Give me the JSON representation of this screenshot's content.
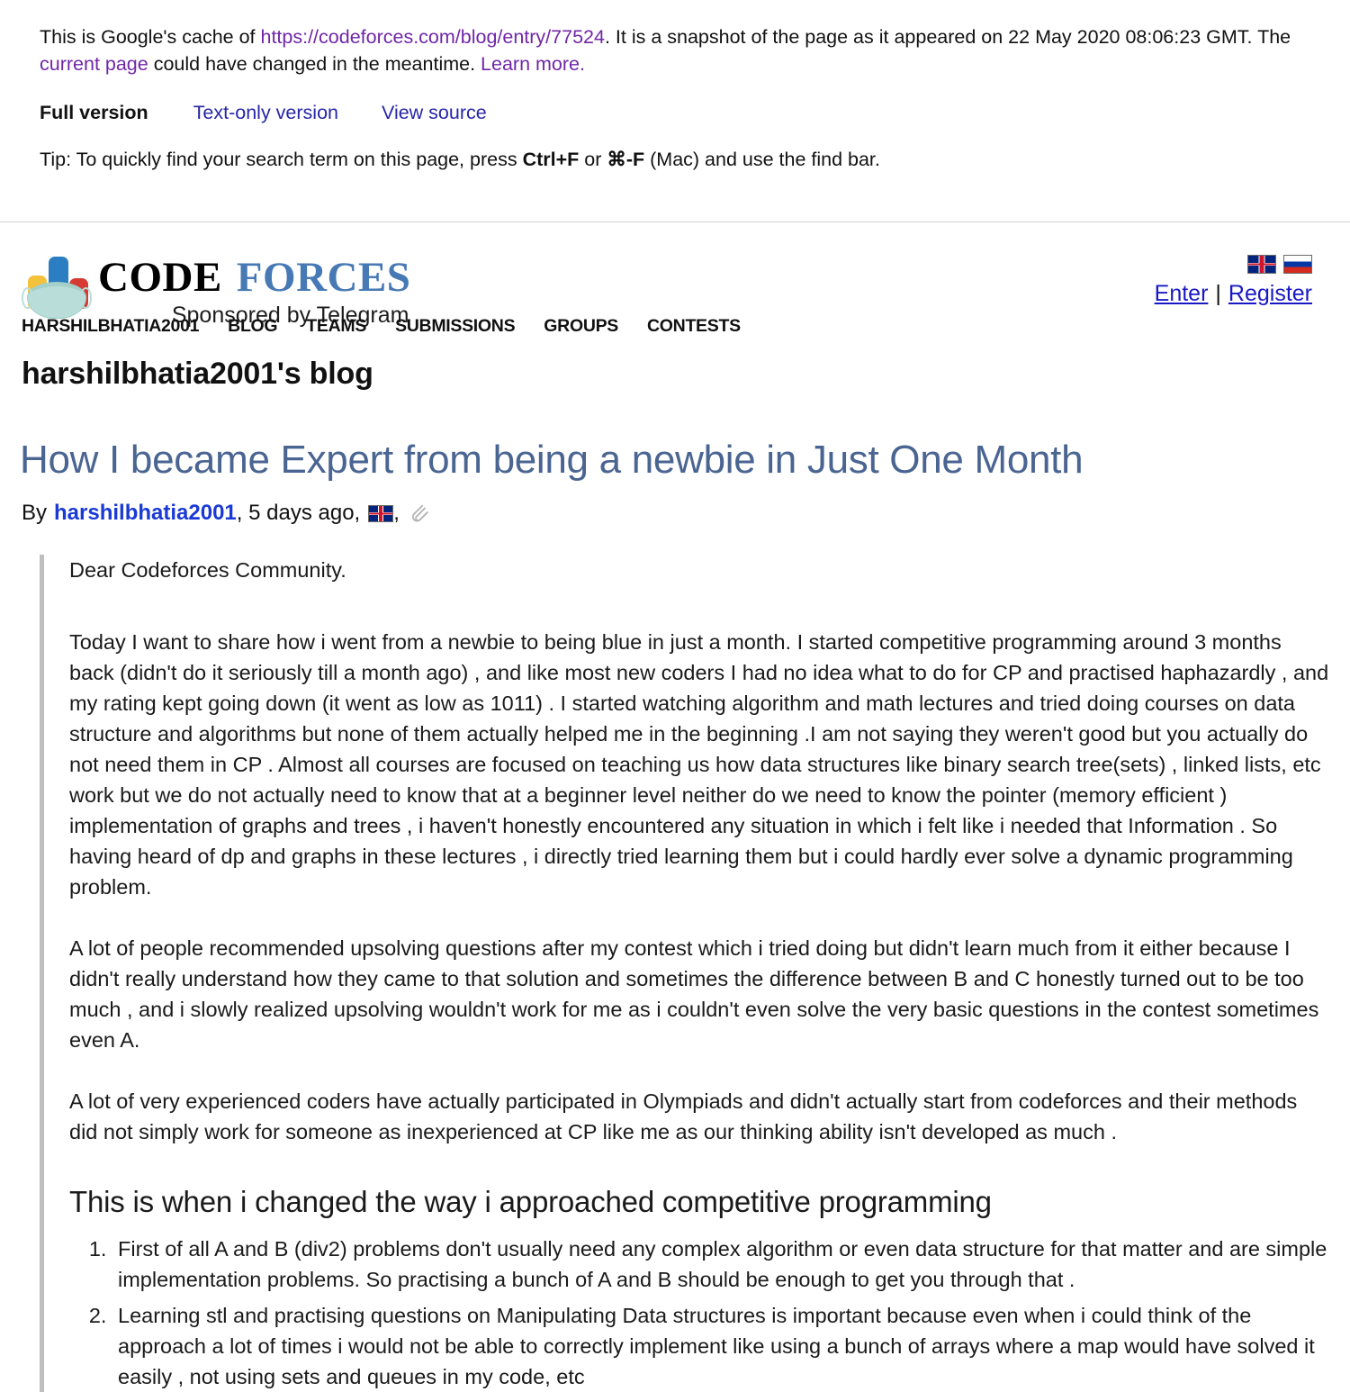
{
  "cache_banner": {
    "intro_prefix": "This is Google's cache of ",
    "cached_url": "https://codeforces.com/blog/entry/77524",
    "intro_middle": ". It is a snapshot of the page as it appeared on 22 May 2020 08:06:23 GMT. The ",
    "current_page_link": "current page",
    "intro_suffix": " could have changed in the meantime. ",
    "learn_more_link": "Learn more.",
    "full_version": "Full version",
    "text_only_version": "Text-only version",
    "view_source": "View source",
    "tip_prefix": "Tip: To quickly find your search term on this page, press ",
    "tip_shortcut_1": "Ctrl+F",
    "tip_or": " or ",
    "tip_shortcut_2": "⌘-F",
    "tip_suffix": " (Mac) and use the find bar."
  },
  "site_header": {
    "logo_word_1": "CODE",
    "logo_word_2": "FORCES",
    "logo_tagline": "Sponsored by Telegram",
    "flag_en": "united-kingdom-flag",
    "flag_ru": "russia-flag",
    "enter_label": "Enter",
    "separator": "|",
    "register_label": "Register"
  },
  "nav": {
    "items": [
      {
        "label": "HARSHILBHATIA2001"
      },
      {
        "label": "BLOG"
      },
      {
        "label": "TEAMS"
      },
      {
        "label": "SUBMISSIONS"
      },
      {
        "label": "GROUPS"
      },
      {
        "label": "CONTESTS"
      }
    ]
  },
  "blog": {
    "owner_heading": "harshilbhatia2001's blog",
    "post_title": "How I became Expert from being a newbie in Just One Month",
    "byline_by": "By",
    "byline_author": "harshilbhatia2001",
    "byline_comma_1": ",",
    "byline_time": "5 days ago",
    "byline_comma_2": ",",
    "byline_comma_3": ","
  },
  "post_body": {
    "greeting": "Dear Codeforces Community.",
    "paragraph_1": "Today I want to share how i went from a newbie to being blue in just a month. I started competitive programming around 3 months back (didn't do it seriously till a month ago) , and like most new coders I had no idea what to do for CP and practised haphazardly , and my rating kept going down (it went as low as 1011) . I started watching algorithm and math lectures and tried doing courses on data structure and algorithms but none of them actually helped me in the beginning .I am not saying they weren't good but you actually do not need them in CP . Almost all courses are focused on teaching us how data structures like binary search tree(sets) , linked lists, etc work but we do not actually need to know that at a beginner level neither do we need to know the pointer (memory efficient ) implementation of graphs and trees , i haven't honestly encountered any situation in which i felt like i needed that Information . So having heard of dp and graphs in these lectures , i directly tried learning them but i could hardly ever solve a dynamic programming problem.",
    "paragraph_2": "A lot of people recommended upsolving questions after my contest which i tried doing but didn't learn much from it either because I didn't really understand how they came to that solution and sometimes the difference between B and C honestly turned out to be too much , and i slowly realized upsolving wouldn't work for me as i couldn't even solve the very basic questions in the contest sometimes even A.",
    "paragraph_3": "A lot of very experienced coders have actually participated in Olympiads and didn't actually start from codeforces and their methods did not simply work for someone as inexperienced at CP like me as our thinking ability isn't developed as much .",
    "section_heading": "This is when i changed the way i approached competitive programming",
    "list_items": [
      "First of all A and B (div2) problems don't usually need any complex algorithm or even data structure for that matter and are simple implementation problems. So practising a bunch of A and B should be enough to get you through that .",
      "Learning stl and practising questions on Manipulating Data structures is important because even when i could think of the approach a lot of times i would not be able to correctly implement like using a bunch of arrays where a map would have solved it easily , not using sets and queues in my code, etc"
    ]
  },
  "colors": {
    "cache_link": "#7126a8",
    "cache_version_link": "#2626a8",
    "post_title": "#4a6592",
    "author_blue": "#1a39d6",
    "logo_forces_blue": "#4779b5",
    "auth_link": "#1919c4",
    "quote_border": "#bfbfbf"
  }
}
